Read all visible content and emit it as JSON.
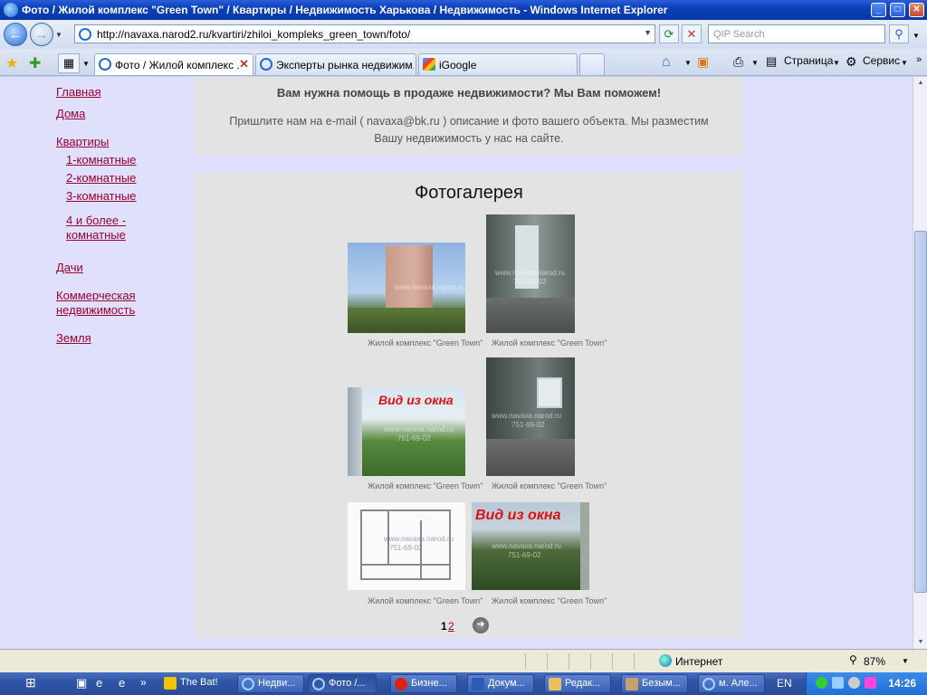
{
  "window": {
    "title": "Фото / Жилой комплекс \"Green Town\" / Квартиры / Недвижимость Харькова / Недвижимость - Windows Internet Explorer",
    "minimize": "_",
    "maximize": "□",
    "close": "✕"
  },
  "toolbar": {
    "back": "←",
    "forward": "→",
    "url": "http://navaxa.narod2.ru/kvartiri/zhiloi_kompleks_green_town/foto/",
    "search_placeholder": "QIP Search"
  },
  "tabs": [
    {
      "label": "Фото / Жилой комплекс ...",
      "icon": "ie-page-icon",
      "active": true
    },
    {
      "label": "Эксперты рынка недвижим...",
      "icon": "ie-page-icon",
      "active": false
    },
    {
      "label": "iGoogle",
      "icon": "google-icon",
      "active": false
    }
  ],
  "commands": {
    "page": "Страница",
    "tools": "Сервис"
  },
  "sidebar": {
    "items": [
      {
        "label": "Главная"
      },
      {
        "label": "Дома"
      },
      {
        "label": "Квартиры"
      },
      {
        "label": "1-комнатные"
      },
      {
        "label": "2-комнатные"
      },
      {
        "label": "3-комнатные"
      },
      {
        "label": "4 и более -"
      },
      {
        "label": "комнатные"
      },
      {
        "label": "Дачи"
      },
      {
        "label": "Коммерческая"
      },
      {
        "label": "недвижимость"
      },
      {
        "label": "Земля"
      }
    ]
  },
  "promo": {
    "heading": "Вам нужна помощь в продаже недвижимости? Мы Вам поможем!",
    "line1": "Пришлите нам на e-mail ( navaxa@bk.ru ) описание и фото вашего объекта. Мы разместим",
    "line2": "Вашу недвижимость у нас на сайте."
  },
  "gallery": {
    "title": "Фотогалерея",
    "watermark": "www.navaxa.narod.ru",
    "watermark_phone": "751-69-02",
    "window_view_label": "Вид из окна",
    "photos": [
      {
        "caption": "Жилой комплекс \"Green Town\""
      },
      {
        "caption": "Жилой комплекс \"Green Town\""
      },
      {
        "caption": "Жилой комплекс \"Green Town\""
      },
      {
        "caption": "Жилой комплекс \"Green Town\""
      },
      {
        "caption": "Жилой комплекс \"Green Town\""
      },
      {
        "caption": "Жилой комплекс \"Green Town\""
      }
    ],
    "pager": {
      "current": "1",
      "next_page": "2",
      "next_arrow": "➜"
    }
  },
  "statusbar": {
    "zone": "Интернет",
    "zoom": "87%"
  },
  "taskbar": {
    "items": [
      {
        "label": "The Bat!"
      },
      {
        "label": "Недви..."
      },
      {
        "label": "Фото /..."
      },
      {
        "label": "Бизне..."
      },
      {
        "label": "Докум..."
      },
      {
        "label": "Редак..."
      },
      {
        "label": "Безым..."
      },
      {
        "label": "м. Але..."
      }
    ],
    "language": "EN",
    "clock": "14:26"
  }
}
